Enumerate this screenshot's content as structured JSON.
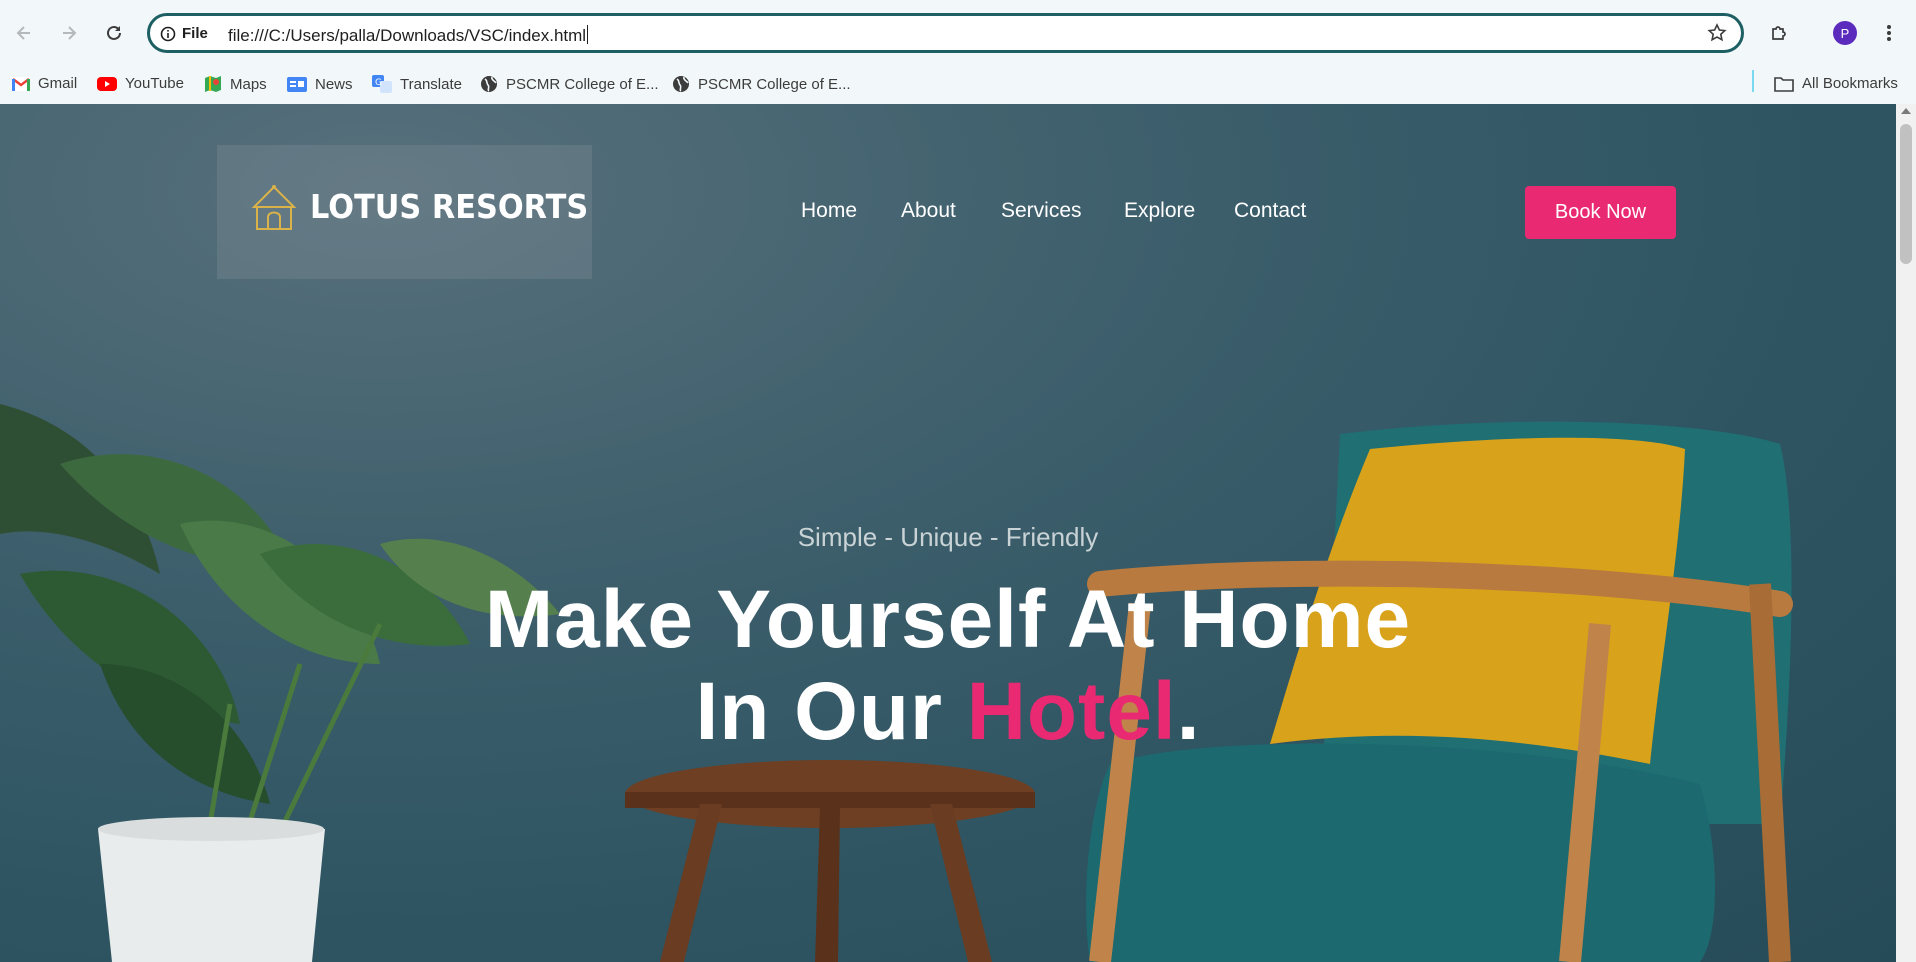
{
  "browser": {
    "site_info_label": "File",
    "url": "file:///C:/Users/palla/Downloads/VSC/index.html",
    "profile_initial": "P",
    "bookmarks": [
      {
        "label": "Gmail",
        "icon": "gmail-icon"
      },
      {
        "label": "YouTube",
        "icon": "youtube-icon"
      },
      {
        "label": "Maps",
        "icon": "maps-icon"
      },
      {
        "label": "News",
        "icon": "news-icon"
      },
      {
        "label": "Translate",
        "icon": "translate-icon"
      },
      {
        "label": "PSCMR College of E...",
        "icon": "globe-icon"
      },
      {
        "label": "PSCMR College of E...",
        "icon": "globe-icon"
      }
    ],
    "all_bookmarks_label": "All Bookmarks"
  },
  "site": {
    "logo_text": "LOTUS RESORTS",
    "nav": [
      "Home",
      "About",
      "Services",
      "Explore",
      "Contact"
    ],
    "cta_label": "Book Now",
    "tagline": "Simple - Unique - Friendly",
    "headline_line1": "Make Yourself At Home",
    "headline_line2_prefix": "In Our ",
    "headline_accent": "Hotel",
    "headline_suffix": "."
  },
  "colors": {
    "accent": "#e92a73",
    "omnibox_border": "#1d5f63",
    "hero_background": "#2f5563",
    "chair_seat": "#1f6f73",
    "pillow": "#d9a21b"
  }
}
